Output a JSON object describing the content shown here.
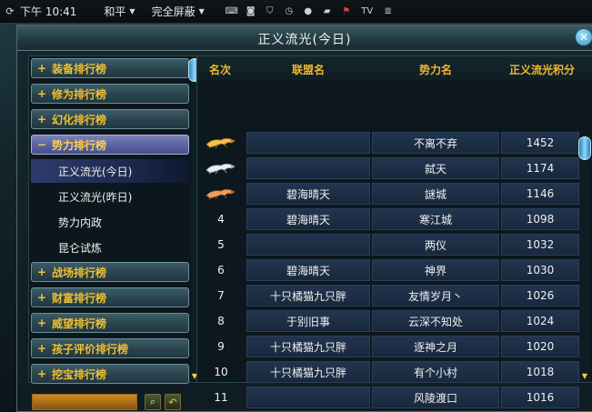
{
  "topbar": {
    "time": "下午 10:41",
    "mode": "和平",
    "screen": "完全屏蔽",
    "tv": "TV"
  },
  "window": {
    "title": "正义流光(今日)"
  },
  "sidebar": {
    "categories": [
      {
        "label": "装备排行榜",
        "expanded": false
      },
      {
        "label": "修为排行榜",
        "expanded": false
      },
      {
        "label": "幻化排行榜",
        "expanded": false
      },
      {
        "label": "势力排行榜",
        "expanded": true
      },
      {
        "label": "战场排行榜",
        "expanded": false
      },
      {
        "label": "财富排行榜",
        "expanded": false
      },
      {
        "label": "威望排行榜",
        "expanded": false
      },
      {
        "label": "孩子评价排行榜",
        "expanded": false
      },
      {
        "label": "挖宝排行榜",
        "expanded": false
      }
    ],
    "subitems": [
      "正义流光(今日)",
      "正义流光(昨日)",
      "势力内政",
      "昆仑试炼"
    ],
    "selected_subitem": "正义流光(今日)",
    "plus": "+",
    "minus": "−"
  },
  "table": {
    "columns": [
      "名次",
      "联盟名",
      "势力名",
      "正义流光积分"
    ],
    "rows": [
      {
        "rank": "",
        "medal": "gold-leopard",
        "alliance": "",
        "force": "不离不弃",
        "score": "1452"
      },
      {
        "rank": "",
        "medal": "silver-leopard",
        "alliance": "",
        "force": "弑天",
        "score": "1174"
      },
      {
        "rank": "",
        "medal": "bronze-leopard",
        "alliance": "碧海晴天",
        "force": "謎城",
        "score": "1146"
      },
      {
        "rank": "4",
        "medal": "",
        "alliance": "碧海晴天",
        "force": "寒江城",
        "score": "1098"
      },
      {
        "rank": "5",
        "medal": "",
        "alliance": "",
        "force": "两仪",
        "score": "1032"
      },
      {
        "rank": "6",
        "medal": "",
        "alliance": "碧海晴天",
        "force": "神界",
        "score": "1030"
      },
      {
        "rank": "7",
        "medal": "",
        "alliance": "十只橘猫九只胖",
        "force": "友情岁月丶",
        "score": "1026"
      },
      {
        "rank": "8",
        "medal": "",
        "alliance": "于别旧事",
        "force": "云深不知处",
        "score": "1024"
      },
      {
        "rank": "9",
        "medal": "",
        "alliance": "十只橘猫九只胖",
        "force": "逐神之月",
        "score": "1020"
      },
      {
        "rank": "10",
        "medal": "",
        "alliance": "十只橘猫九只胖",
        "force": "有个小村",
        "score": "1018"
      },
      {
        "rank": "11",
        "medal": "",
        "alliance": "",
        "force": "风陵渡口",
        "score": "1016"
      }
    ]
  },
  "colors": {
    "category_text": "#f0c030",
    "header_text": "#f0b830",
    "accent_blue": "#8fd8ff"
  },
  "search": {
    "value": ""
  }
}
